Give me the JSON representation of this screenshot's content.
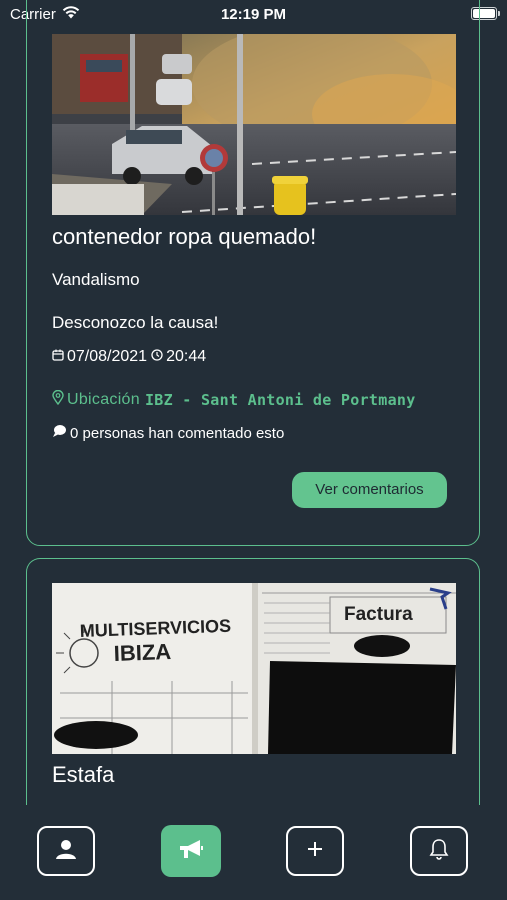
{
  "status_bar": {
    "carrier": "Carrier",
    "time": "12:19 PM"
  },
  "posts": [
    {
      "title": "contenedor ropa quemado!",
      "category": "Vandalismo",
      "description": "Desconozco la causa!",
      "date": "07/08/2021",
      "time": "20:44",
      "location_label": "Ubicación",
      "location": "IBZ - Sant Antoni de Portmany",
      "comments_text": "0 personas han comentado esto",
      "button_label": "Ver comentarios"
    },
    {
      "title": "Estafa",
      "photo_text": {
        "company_line1": "MULTISERVICIOS",
        "company_line2": "IBIZA",
        "doc_title": "Factura"
      }
    }
  ],
  "tabbar": {
    "items": [
      {
        "icon": "user-icon",
        "active": false
      },
      {
        "icon": "megaphone-icon",
        "active": true
      },
      {
        "icon": "plus-icon",
        "active": false
      },
      {
        "icon": "bell-icon",
        "active": false
      }
    ]
  },
  "colors": {
    "background": "#232e38",
    "accent": "#5cbf8d",
    "button": "#63c48f"
  }
}
